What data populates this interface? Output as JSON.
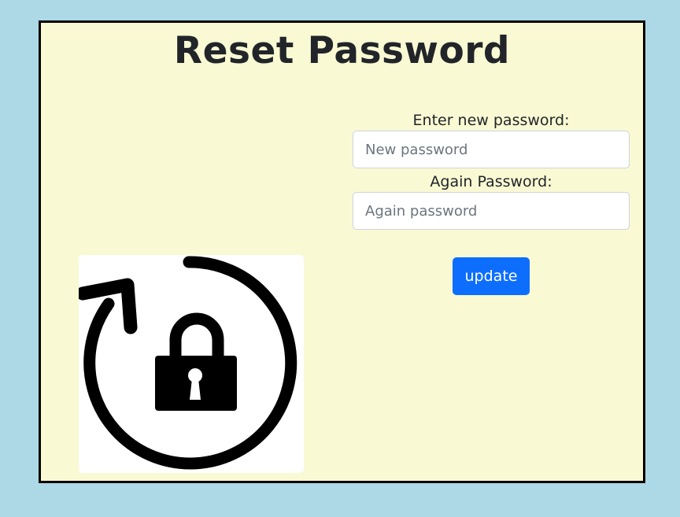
{
  "page": {
    "title": "Reset Password"
  },
  "illustration": {
    "icon": "reset-lock-icon"
  },
  "form": {
    "new_password": {
      "label": "Enter new password:",
      "placeholder": "New password",
      "value": ""
    },
    "again_password": {
      "label": "Again Password:",
      "placeholder": "Again password",
      "value": ""
    },
    "submit_label": "update"
  },
  "colors": {
    "background": "#add8e6",
    "card": "#f9f9d3",
    "button": "#0d6efd"
  }
}
